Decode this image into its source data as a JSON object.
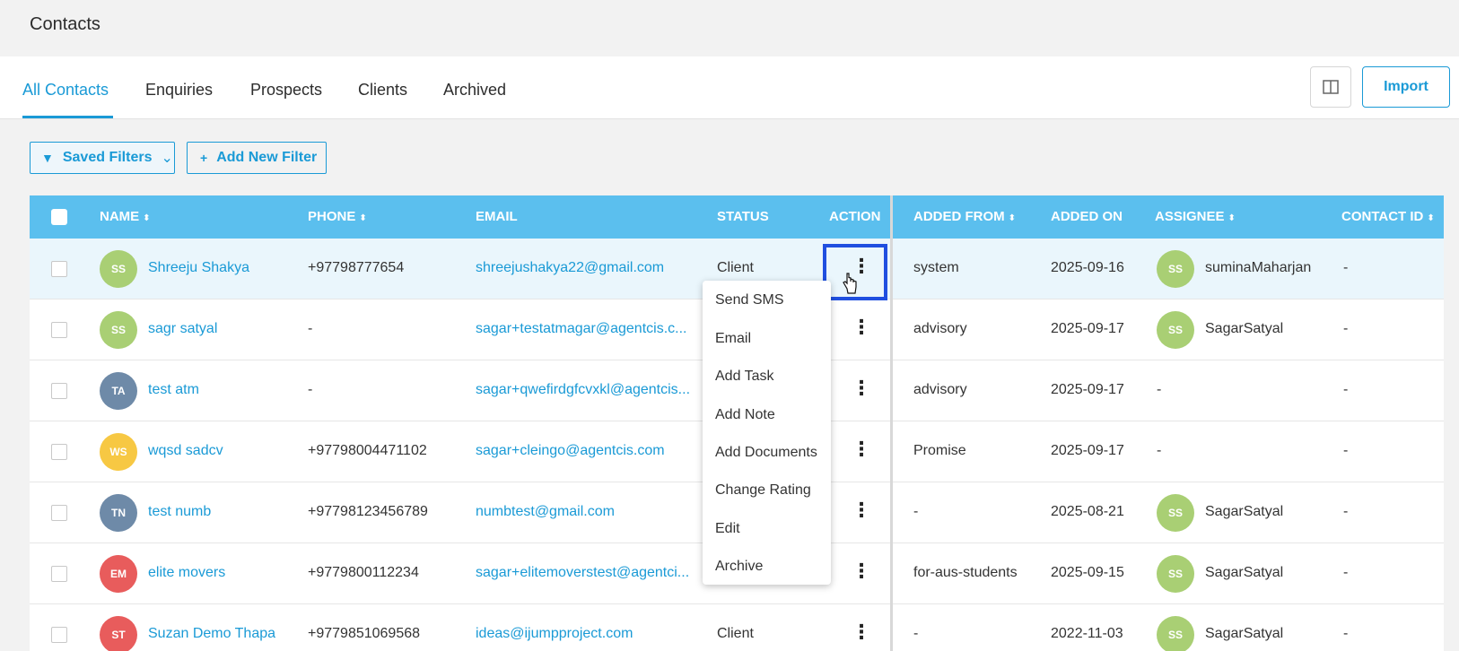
{
  "page": {
    "title": "Contacts"
  },
  "tabs": [
    {
      "label": "All Contacts",
      "active": true
    },
    {
      "label": "Enquiries"
    },
    {
      "label": "Prospects"
    },
    {
      "label": "Clients"
    },
    {
      "label": "Archived"
    }
  ],
  "toolbar": {
    "import_label": "Import",
    "layout_icon": "columns-icon"
  },
  "filters": {
    "saved_label": "Saved Filters",
    "add_label": "Add New Filter"
  },
  "table": {
    "headers": {
      "name": "NAME",
      "phone": "PHONE",
      "email": "EMAIL",
      "status": "STATUS",
      "action": "ACTION",
      "added_from": "ADDED FROM",
      "added_on": "ADDED ON",
      "assignee": "ASSIGNEE",
      "contact_id": "CONTACT ID"
    },
    "rows": [
      {
        "initials": "SS",
        "avatar_color": "#a9cf74",
        "name": "Shreeju Shakya",
        "phone": "+97798777654",
        "email": "shreejushakya22@gmail.com",
        "status": "Client",
        "added_from": "system",
        "added_on": "2025-09-16",
        "assignee_initials": "SS",
        "assignee": "suminaMaharjan",
        "contact_id": "-"
      },
      {
        "initials": "SS",
        "avatar_color": "#a9cf74",
        "name": "sagr satyal",
        "phone": "-",
        "email": "sagar+testatmagar@agentcis.c...",
        "status": "",
        "added_from": "advisory",
        "added_on": "2025-09-17",
        "assignee_initials": "SS",
        "assignee": "SagarSatyal",
        "contact_id": "-"
      },
      {
        "initials": "TA",
        "avatar_color": "#6e8aa8",
        "name": "test atm",
        "phone": "-",
        "email": "sagar+qwefirdgfcvxkl@agentcis...",
        "status": "",
        "added_from": "advisory",
        "added_on": "2025-09-17",
        "assignee_initials": "",
        "assignee": "-",
        "contact_id": "-"
      },
      {
        "initials": "WS",
        "avatar_color": "#f7c843",
        "name": "wqsd sadcv",
        "phone": "+97798004471102",
        "email": "sagar+cleingo@agentcis.com",
        "status": "",
        "added_from": "Promise",
        "added_on": "2025-09-17",
        "assignee_initials": "",
        "assignee": "-",
        "contact_id": "-"
      },
      {
        "initials": "TN",
        "avatar_color": "#6e8aa8",
        "name": "test numb",
        "phone": "+97798123456789",
        "email": "numbtest@gmail.com",
        "status": "",
        "added_from": "-",
        "added_on": "2025-08-21",
        "assignee_initials": "SS",
        "assignee": "SagarSatyal",
        "contact_id": "-"
      },
      {
        "initials": "EM",
        "avatar_color": "#e85c5c",
        "name": "elite movers",
        "phone": "+9779800112234",
        "email": "sagar+elitemoverstest@agentci...",
        "status": "",
        "added_from": "for-aus-students",
        "added_on": "2025-09-15",
        "assignee_initials": "SS",
        "assignee": "SagarSatyal",
        "contact_id": "-"
      },
      {
        "initials": "ST",
        "avatar_color": "#e85c5c",
        "name": "Suzan Demo Thapa",
        "phone": "+9779851069568",
        "email": "ideas@ijumpproject.com",
        "status": "Client",
        "added_from": "-",
        "added_on": "2022-11-03",
        "assignee_initials": "SS",
        "assignee": "SagarSatyal",
        "contact_id": "-"
      }
    ]
  },
  "action_menu": [
    "Send SMS",
    "Email",
    "Add Task",
    "Add Note",
    "Add Documents",
    "Change Rating",
    "Edit",
    "Archive"
  ],
  "colors": {
    "accent": "#1a9ad6",
    "header_bg": "#5bbfee",
    "focus": "#1f4fe0"
  }
}
